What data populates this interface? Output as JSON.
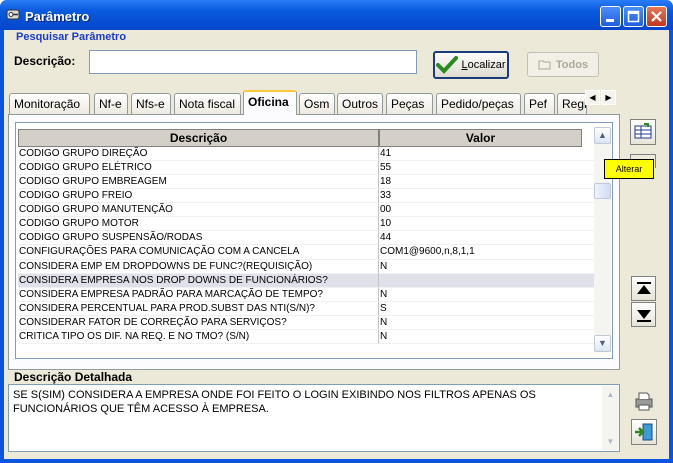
{
  "window": {
    "title": "Parâmetro"
  },
  "search": {
    "legend": "Pesquisar Parâmetro",
    "label": "Descrição:",
    "value": "",
    "localizar_label": "Localizar",
    "localizar_underline": "L",
    "localizar_rest": "ocalizar",
    "todos_label": "Todos"
  },
  "tabs": [
    "Monitoração",
    "Nf-e",
    "Nfs-e",
    "Nota fiscal",
    "Oficina",
    "Osm",
    "Outros",
    "Peças",
    "Pedido/peças",
    "Pef",
    "Regi"
  ],
  "active_tab": "Oficina",
  "grid": {
    "columns": [
      "Descrição",
      "Valor"
    ],
    "rows": [
      {
        "descricao": "CODIGO GRUPO DIREÇÃO",
        "valor": "41"
      },
      {
        "descricao": "CODIGO GRUPO ELÉTRICO",
        "valor": "55"
      },
      {
        "descricao": "CODIGO GRUPO EMBREAGEM",
        "valor": "18"
      },
      {
        "descricao": "CODIGO GRUPO FREIO",
        "valor": "33"
      },
      {
        "descricao": "CODIGO GRUPO MANUTENÇÃO",
        "valor": "00"
      },
      {
        "descricao": "CODIGO GRUPO MOTOR",
        "valor": "10"
      },
      {
        "descricao": "CODIGO GRUPO SUSPENSÃO/RODAS",
        "valor": "44"
      },
      {
        "descricao": "CONFIGURAÇÕES PARA COMUNICAÇÃO COM A CANCELA",
        "valor": "COM1@9600,n,8,1,1"
      },
      {
        "descricao": "CONSIDERA EMP EM DROPDOWNS DE FUNC?(REQUISIÇÃO)",
        "valor": "N"
      },
      {
        "descricao": "CONSIDERA EMPRESA NOS DROP DOWNS DE FUNCIONÁRIOS?",
        "valor": ""
      },
      {
        "descricao": "CONSIDERA EMPRESA PADRÃO PARA MARCAÇÃO DE TEMPO?",
        "valor": "N"
      },
      {
        "descricao": "CONSIDERA PERCENTUAL PARA PROD.SUBST DAS NTI(S/N)?",
        "valor": "S"
      },
      {
        "descricao": "CONSIDERAR FATOR DE CORREÇÃO PARA SERVIÇOS?",
        "valor": "N"
      },
      {
        "descricao": "CRITICA TIPO OS DIF. NA REQ. E NO TMO? (S/N)",
        "valor": "N"
      }
    ],
    "selected_row_index": 9
  },
  "tooltip": "Alterar",
  "detail": {
    "label": "Descrição Detalhada",
    "text": "SE S(SIM) CONSIDERA A EMPRESA ONDE FOI FEITO O LOGIN EXIBINDO NOS FILTROS APENAS OS FUNCIONÁRIOS QUE TÊM ACESSO À EMPRESA."
  },
  "icons": {
    "alterar": "edit-grid-icon",
    "up": "move-to-top-icon",
    "down": "move-to-bottom-icon",
    "print": "print-icon",
    "exit": "exit-door-icon"
  },
  "colors": {
    "title_bar": "#0a5bdf",
    "client_bg": "#ece9d8",
    "legend_blue": "#1a3cc6",
    "tooltip_bg": "#ffff00",
    "selected_row": "#e0e0ea",
    "active_tab_accent": "#ffc73c"
  }
}
